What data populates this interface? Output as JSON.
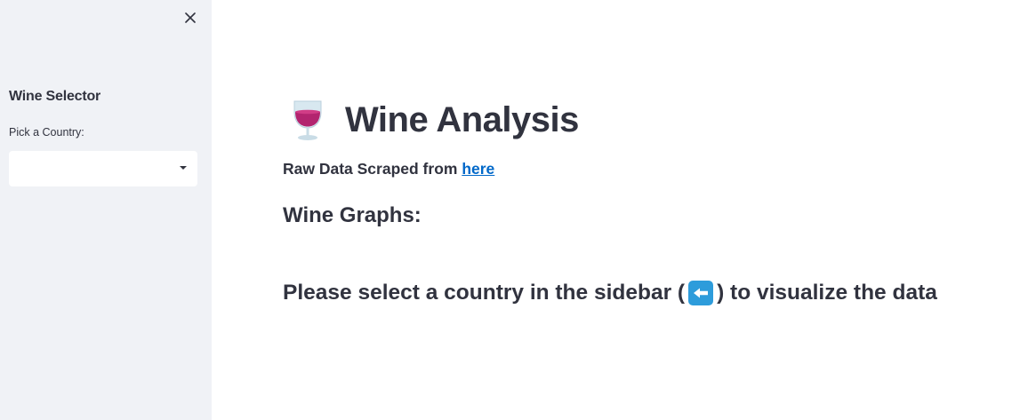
{
  "sidebar": {
    "heading": "Wine Selector",
    "select_label": "Pick a Country:",
    "select_value": "",
    "close_icon": "close-icon",
    "background": "#f0f2f6"
  },
  "main": {
    "title_icon": "wine-glass-icon",
    "title": "Wine Analysis",
    "source_prefix": "Raw Data Scraped from ",
    "source_link": "here",
    "graphs_heading": "Wine Graphs:",
    "instruction_before": "Please select a country in the sidebar (",
    "instruction_icon": "left-arrow-icon",
    "instruction_after": ") to visualize the data",
    "link_color": "#0068c9",
    "text_color": "#31333f"
  }
}
